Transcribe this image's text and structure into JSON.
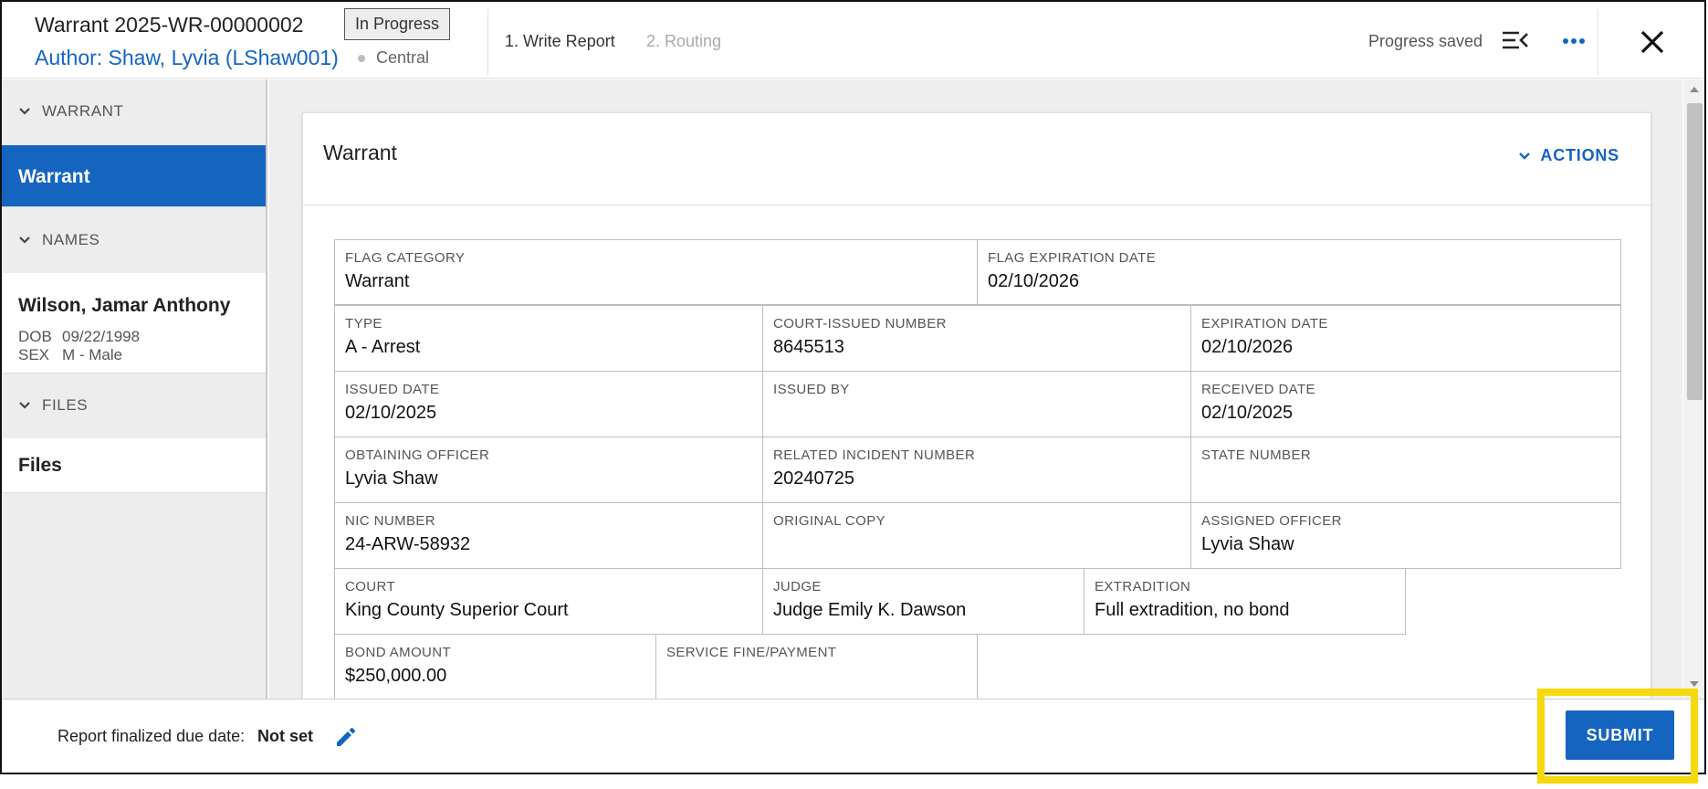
{
  "header": {
    "title": "Warrant 2025-WR-00000002",
    "status": "In Progress",
    "author": "Author: Shaw, Lyvia (LShaw001)",
    "location": "Central",
    "steps": [
      {
        "label": "1. Write Report",
        "active": true
      },
      {
        "label": "2. Routing",
        "active": false
      }
    ],
    "progress_text": "Progress saved",
    "icons": [
      "collapse-menu-icon",
      "more-horizontal-icon",
      "close-icon"
    ]
  },
  "sidebar": {
    "sections": [
      {
        "header": "WARRANT",
        "items": [
          {
            "label": "Warrant",
            "active": true
          }
        ]
      },
      {
        "header": "NAMES",
        "items": [
          {
            "label": "Wilson, Jamar Anthony",
            "dob_label": "DOB",
            "dob": "09/22/1998",
            "sex_label": "SEX",
            "sex": "M - Male"
          }
        ]
      },
      {
        "header": "FILES",
        "items": [
          {
            "label": "Files"
          }
        ]
      }
    ]
  },
  "card": {
    "title": "Warrant",
    "actions_label": "ACTIONS",
    "fields": [
      {
        "label": "FLAG CATEGORY",
        "value": "Warrant"
      },
      {
        "label": "FLAG EXPIRATION DATE",
        "value": "02/10/2026"
      },
      {
        "label": "TYPE",
        "value": "A - Arrest"
      },
      {
        "label": "COURT-ISSUED NUMBER",
        "value": "8645513"
      },
      {
        "label": "EXPIRATION DATE",
        "value": "02/10/2026"
      },
      {
        "label": "ISSUED DATE",
        "value": "02/10/2025"
      },
      {
        "label": "ISSUED BY",
        "value": ""
      },
      {
        "label": "RECEIVED DATE",
        "value": "02/10/2025"
      },
      {
        "label": "OBTAINING OFFICER",
        "value": "Lyvia Shaw"
      },
      {
        "label": "RELATED INCIDENT NUMBER",
        "value": "20240725"
      },
      {
        "label": "STATE NUMBER",
        "value": ""
      },
      {
        "label": "NIC NUMBER",
        "value": "24-ARW-58932"
      },
      {
        "label": "ORIGINAL COPY",
        "value": ""
      },
      {
        "label": "ASSIGNED OFFICER",
        "value": "Lyvia Shaw"
      },
      {
        "label": "COURT",
        "value": "King County Superior Court"
      },
      {
        "label": "JUDGE",
        "value": "Judge Emily K. Dawson"
      },
      {
        "label": "EXTRADITION",
        "value": "Full extradition, no bond"
      },
      {
        "label": "BOND AMOUNT",
        "value": "$250,000.00"
      },
      {
        "label": "SERVICE FINE/PAYMENT",
        "value": ""
      }
    ]
  },
  "footer": {
    "due_label": "Report finalized due date:",
    "due_value": "Not set",
    "submit_label": "SUBMIT"
  },
  "colors": {
    "primary": "#1565c0",
    "highlight": "#f5d90a",
    "sidebar_bg": "#ededed"
  }
}
